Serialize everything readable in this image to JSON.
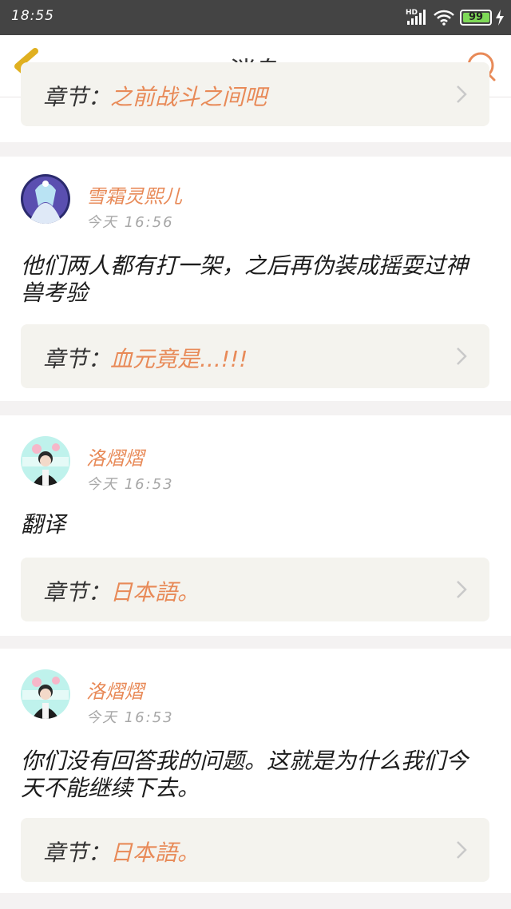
{
  "status": {
    "time": "18:55",
    "network": "HD",
    "battery": "99"
  },
  "nav": {
    "title": "消息"
  },
  "colors": {
    "accent": "#e88a58",
    "back": "#e0b020",
    "statusbar": "#444444"
  },
  "top_partial": {
    "label": "章节：",
    "value": "之前战斗之间吧"
  },
  "messages": [
    {
      "name": "雪霜灵熙儿",
      "time": "今天 16:56",
      "content": "他们两人都有打一架，之后再伪装成摇耍过神兽考验",
      "chapter_label": "章节：",
      "chapter_value": "血元竟是...!!!"
    },
    {
      "name": "洛熠熠",
      "time": "今天 16:53",
      "content": "翻译",
      "chapter_label": "章节：",
      "chapter_value": "日本語。"
    },
    {
      "name": "洛熠熠",
      "time": "今天 16:53",
      "content": "你们没有回答我的问题。这就是为什么我们今天不能继续下去。",
      "chapter_label": "章节：",
      "chapter_value": "日本語。"
    }
  ]
}
